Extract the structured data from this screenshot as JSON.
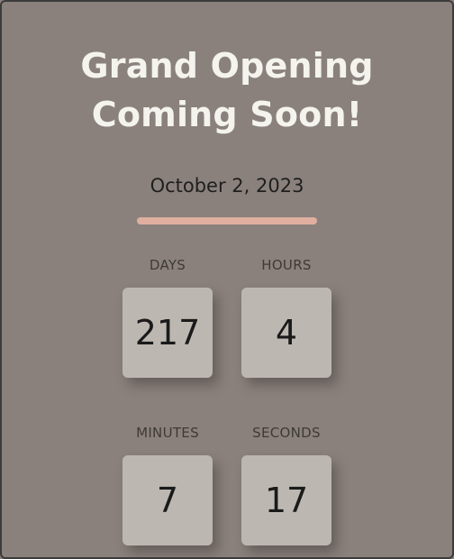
{
  "header": {
    "title_line1": "Grand Opening",
    "title_line2": "Coming Soon!"
  },
  "event": {
    "date": "October 2, 2023"
  },
  "countdown": {
    "days": {
      "label": "DAYS",
      "value": "217"
    },
    "hours": {
      "label": "HOURS",
      "value": "4"
    },
    "minutes": {
      "label": "MINUTES",
      "value": "7"
    },
    "seconds": {
      "label": "SECONDS",
      "value": "17"
    }
  },
  "colors": {
    "background": "#8a817c",
    "title": "#f4f3ee",
    "accent": "#e0afa0",
    "tile": "#bcb8b1"
  }
}
